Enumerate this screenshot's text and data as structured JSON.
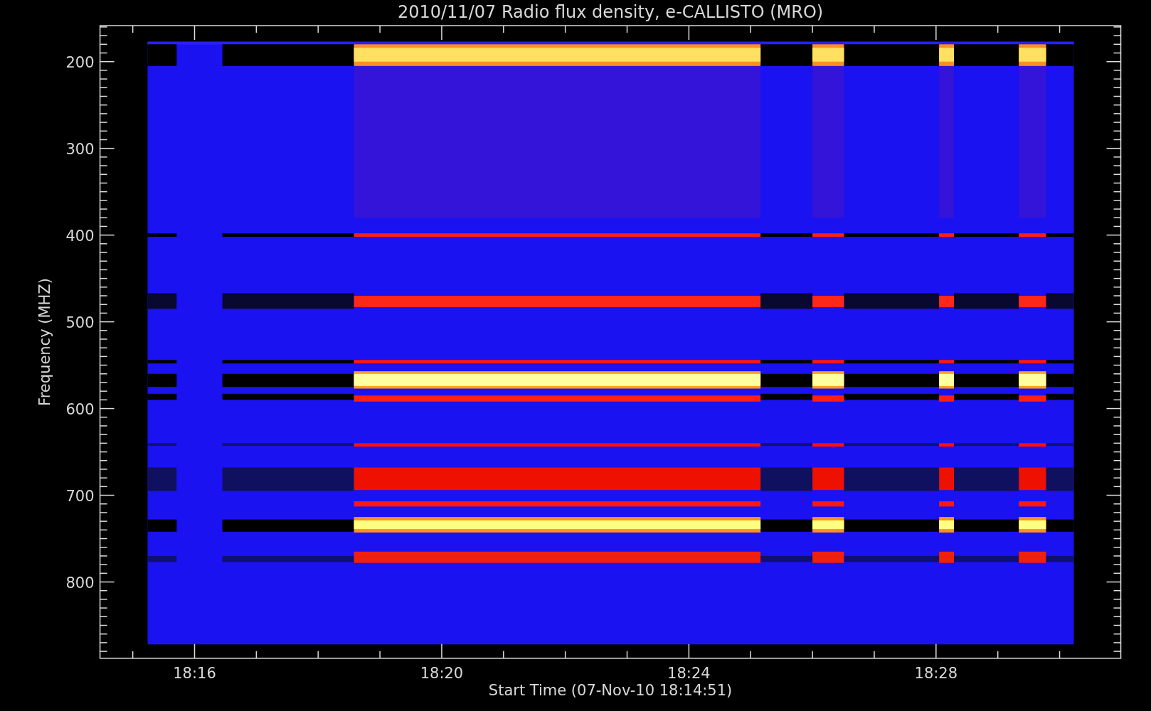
{
  "title": "2010/11/07  Radio flux density, e-CALLISTO (MRO)",
  "y_axis": {
    "label": "Frequency (MHZ)",
    "ticks": [
      "200",
      "300",
      "400",
      "500",
      "600",
      "700",
      "800"
    ]
  },
  "x_axis": {
    "label": "Start Time (07-Nov-10 18:14:51)",
    "ticks": [
      "18:16",
      "18:20",
      "18:24",
      "18:28"
    ]
  }
}
